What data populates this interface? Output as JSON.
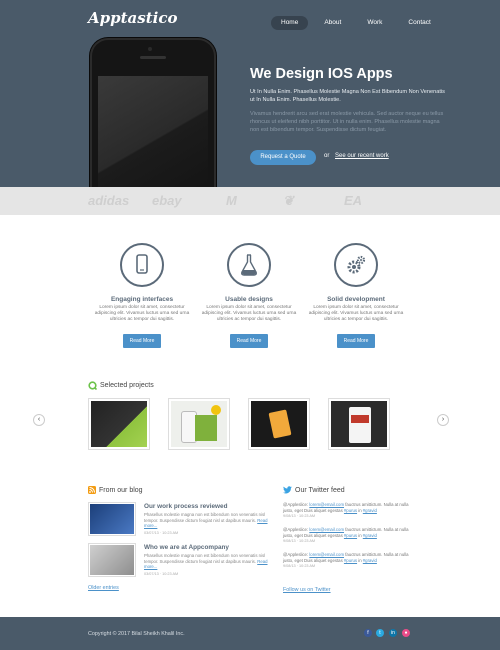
{
  "header": {
    "logo": "Apptastico",
    "nav": [
      "Home",
      "About",
      "Work",
      "Contact"
    ]
  },
  "hero": {
    "title": "We Design IOS Apps",
    "lead": "Ut In Nulla Enim. Phasellus Molestie Magna Non Est Bibendum Non Venenatis ut In Nulla Enim. Phasellus Molestie.",
    "sub": "Vivamus hendrerit arcu sed erat molestie vehicula. Sed auctor neque eu tellus rhoncus ut eleifend nibh porttitor. Ut in nulla enim. Phasellus molestie magna non est bibendum tempor. Suspendisse dictum feugiat.",
    "quote_button": "Request a Quote",
    "or": "or",
    "work_link": "See our recent work"
  },
  "clients": [
    "adidas",
    "ebay",
    "M",
    "❦",
    "EA"
  ],
  "features": [
    {
      "icon": "phone-icon",
      "title": "Engaging interfaces",
      "text": "Lorem ipsum dolor sit amet, consectetur adipiscing elit. Vivamus luctus urna sed urna ultricies ac tempor dui sagittis.",
      "button": "Read More"
    },
    {
      "icon": "flask-icon",
      "title": "Usable designs",
      "text": "Lorem ipsum dolor sit amet, consectetur adipiscing elit. Vivamus luctus urna sed urna ultricies ac tempor dui sagittis.",
      "button": "Read More"
    },
    {
      "icon": "gears-icon",
      "title": "Solid development",
      "text": "Lorem ipsum dolor sit amet, consectetur adipiscing elit. Vivamus luctus urna sed urna ultricies ac tempor dui sagittis.",
      "button": "Read More"
    }
  ],
  "projects": {
    "title": "Selected projects"
  },
  "blog": {
    "title": "From our blog",
    "posts": [
      {
        "title": "Our work process reviewed",
        "text": "Phasellus molestie magna non est bibendum non venenatis nisl tempor. Suspendisse dictum feugiat nisl ut dapibus mauris.",
        "more": "Read more...",
        "meta": "03/07/13 · 10:23 AM"
      },
      {
        "title": "Who we are at Appcompany",
        "text": "Phasellus molestie magna non est bibendum non venenatis nisl tempor. Suspendisse dictum feugiat nisl ut dapibus mauris.",
        "more": "Read more...",
        "meta": "03/07/13 · 10:23 AM"
      }
    ],
    "older": "Older entries"
  },
  "twitter": {
    "title": "Our Twitter feed",
    "tweets": [
      {
        "pre": "@Appleslice: ",
        "link": "lorem@email.com",
        "mid": " fauctrus amittictum. Nulla at nulla justo, eget Duis aliquet egestas ",
        "tag": "#purus",
        "post": " in ",
        "tag2": "#gravid",
        "date": "9/08/13 · 10:23 AM"
      },
      {
        "pre": "@Appleslice: ",
        "link": "lorem@email.com",
        "mid": " fauctrus amittictum. Nulla at nulla justo, eget Duis aliquet egestas ",
        "tag": "#purus",
        "post": " in ",
        "tag2": "#gravid",
        "date": "9/08/13 · 10:23 AM"
      },
      {
        "pre": "@Appleslice: ",
        "link": "lorem@email.com",
        "mid": " fauctrus amittictum. Nulla at nulla justo, eget Duis aliquet egestas ",
        "tag": "#purus",
        "post": " in ",
        "tag2": "#gravid",
        "date": "9/08/13 · 10:23 AM"
      }
    ],
    "follow": "Follow us on Twitter"
  },
  "footer": {
    "copyright": "Copyright © 2017 Bilal Sheikh Khalil Inc."
  },
  "colors": {
    "hero_bg": "#4a5a69",
    "accent": "#4b91c9",
    "clients_bg": "#e5e5e5"
  }
}
